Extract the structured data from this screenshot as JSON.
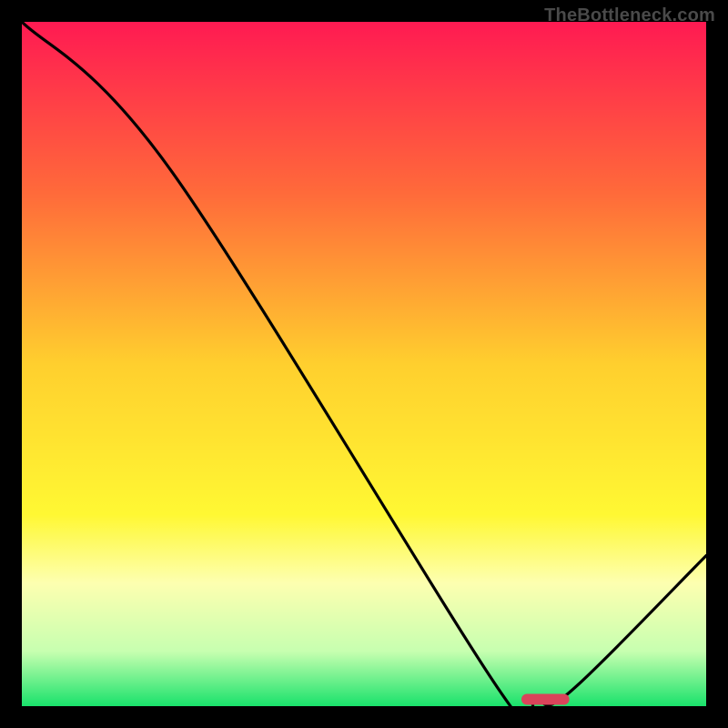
{
  "watermark": "TheBottleneck.com",
  "chart_data": {
    "type": "line",
    "title": "",
    "xlabel": "",
    "ylabel": "",
    "xlim": [
      0,
      100
    ],
    "ylim": [
      0,
      100
    ],
    "grid": false,
    "legend": false,
    "series": [
      {
        "name": "bottleneck-curve",
        "x": [
          0,
          22,
          70,
          75,
          80,
          100
        ],
        "y": [
          100,
          78,
          2,
          1,
          2,
          22
        ]
      }
    ],
    "marker": {
      "name": "optimal-range",
      "color": "#d9445a",
      "shape": "rounded-bar",
      "x_start": 73,
      "x_end": 80,
      "y": 1
    },
    "gradient_stops": [
      {
        "pos": 0.0,
        "color": "#ff1a52"
      },
      {
        "pos": 0.25,
        "color": "#ff6a3a"
      },
      {
        "pos": 0.5,
        "color": "#ffcf2e"
      },
      {
        "pos": 0.72,
        "color": "#fff833"
      },
      {
        "pos": 0.82,
        "color": "#fdffb0"
      },
      {
        "pos": 0.92,
        "color": "#c7ffb0"
      },
      {
        "pos": 1.0,
        "color": "#19e26b"
      }
    ]
  }
}
